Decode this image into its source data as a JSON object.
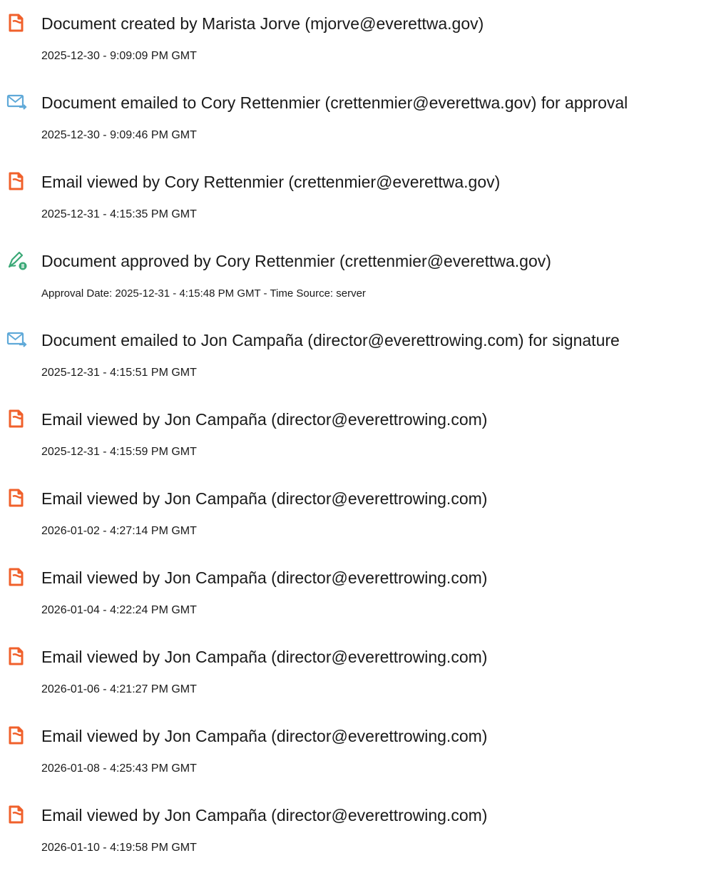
{
  "colors": {
    "pdf_icon": "#f0602b",
    "email_icon": "#5fa9d8",
    "approve_icon": "#3aa876",
    "text": "#1a1a1a"
  },
  "events": [
    {
      "icon": "document-created-icon",
      "title": "Document created by Marista Jorve (mjorve@everettwa.gov)",
      "subtitle": "2025-12-30 - 9:09:09 PM GMT"
    },
    {
      "icon": "email-sent-icon",
      "title": "Document emailed to Cory Rettenmier (crettenmier@everettwa.gov) for approval",
      "subtitle": "2025-12-30 - 9:09:46 PM GMT"
    },
    {
      "icon": "document-viewed-icon",
      "title": "Email viewed by Cory Rettenmier (crettenmier@everettwa.gov)",
      "subtitle": "2025-12-31 - 4:15:35 PM GMT"
    },
    {
      "icon": "approval-pen-icon",
      "title": "Document approved by Cory Rettenmier (crettenmier@everettwa.gov)",
      "subtitle": "Approval Date: 2025-12-31 - 4:15:48 PM GMT - Time Source: server"
    },
    {
      "icon": "email-sent-icon",
      "title": "Document emailed to Jon Campaña (director@everettrowing.com) for signature",
      "subtitle": "2025-12-31 - 4:15:51 PM GMT"
    },
    {
      "icon": "document-viewed-icon",
      "title": "Email viewed by Jon Campaña (director@everettrowing.com)",
      "subtitle": "2025-12-31 - 4:15:59 PM GMT"
    },
    {
      "icon": "document-viewed-icon",
      "title": "Email viewed by Jon Campaña (director@everettrowing.com)",
      "subtitle": "2026-01-02 - 4:27:14 PM GMT"
    },
    {
      "icon": "document-viewed-icon",
      "title": "Email viewed by Jon Campaña (director@everettrowing.com)",
      "subtitle": "2026-01-04 - 4:22:24 PM GMT"
    },
    {
      "icon": "document-viewed-icon",
      "title": "Email viewed by Jon Campaña (director@everettrowing.com)",
      "subtitle": "2026-01-06 - 4:21:27 PM GMT"
    },
    {
      "icon": "document-viewed-icon",
      "title": "Email viewed by Jon Campaña (director@everettrowing.com)",
      "subtitle": "2026-01-08 - 4:25:43 PM GMT"
    },
    {
      "icon": "document-viewed-icon",
      "title": "Email viewed by Jon Campaña (director@everettrowing.com)",
      "subtitle": "2026-01-10 - 4:19:58 PM GMT"
    }
  ]
}
